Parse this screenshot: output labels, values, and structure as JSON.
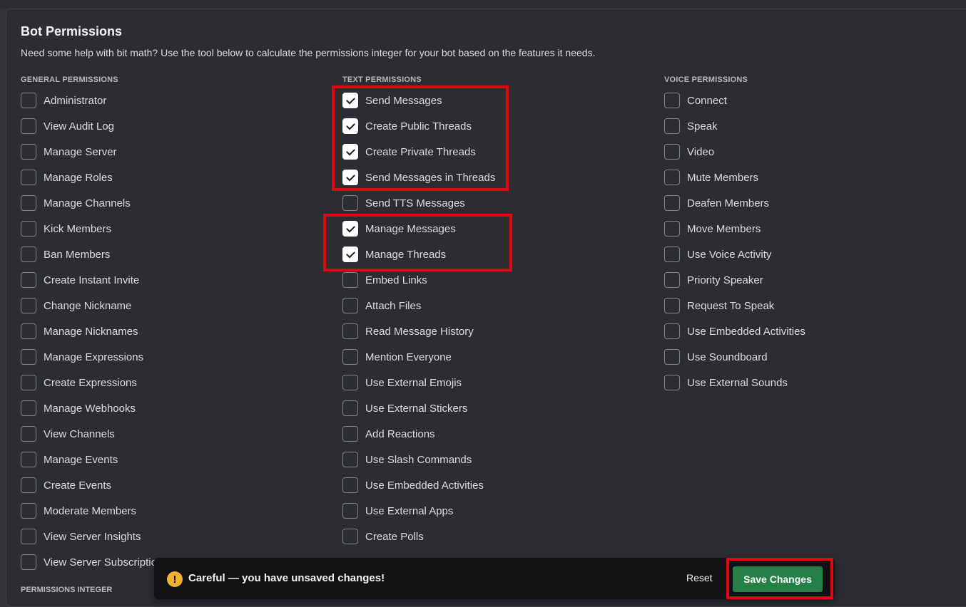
{
  "header": {
    "title": "Bot Permissions",
    "description": "Need some help with bit math? Use the tool below to calculate the permissions integer for your bot based on the features it needs."
  },
  "columns": [
    {
      "heading": "GENERAL PERMISSIONS",
      "items": [
        {
          "label": "Administrator",
          "checked": false
        },
        {
          "label": "View Audit Log",
          "checked": false
        },
        {
          "label": "Manage Server",
          "checked": false
        },
        {
          "label": "Manage Roles",
          "checked": false
        },
        {
          "label": "Manage Channels",
          "checked": false
        },
        {
          "label": "Kick Members",
          "checked": false
        },
        {
          "label": "Ban Members",
          "checked": false
        },
        {
          "label": "Create Instant Invite",
          "checked": false
        },
        {
          "label": "Change Nickname",
          "checked": false
        },
        {
          "label": "Manage Nicknames",
          "checked": false
        },
        {
          "label": "Manage Expressions",
          "checked": false
        },
        {
          "label": "Create Expressions",
          "checked": false
        },
        {
          "label": "Manage Webhooks",
          "checked": false
        },
        {
          "label": "View Channels",
          "checked": false
        },
        {
          "label": "Manage Events",
          "checked": false
        },
        {
          "label": "Create Events",
          "checked": false
        },
        {
          "label": "Moderate Members",
          "checked": false
        },
        {
          "label": "View Server Insights",
          "checked": false
        },
        {
          "label": "View Server Subscriptio",
          "checked": false
        }
      ]
    },
    {
      "heading": "TEXT PERMISSIONS",
      "items": [
        {
          "label": "Send Messages",
          "checked": true
        },
        {
          "label": "Create Public Threads",
          "checked": true
        },
        {
          "label": "Create Private Threads",
          "checked": true
        },
        {
          "label": "Send Messages in Threads",
          "checked": true
        },
        {
          "label": "Send TTS Messages",
          "checked": false
        },
        {
          "label": "Manage Messages",
          "checked": true
        },
        {
          "label": "Manage Threads",
          "checked": true
        },
        {
          "label": "Embed Links",
          "checked": false
        },
        {
          "label": "Attach Files",
          "checked": false
        },
        {
          "label": "Read Message History",
          "checked": false
        },
        {
          "label": "Mention Everyone",
          "checked": false
        },
        {
          "label": "Use External Emojis",
          "checked": false
        },
        {
          "label": "Use External Stickers",
          "checked": false
        },
        {
          "label": "Add Reactions",
          "checked": false
        },
        {
          "label": "Use Slash Commands",
          "checked": false
        },
        {
          "label": "Use Embedded Activities",
          "checked": false
        },
        {
          "label": "Use External Apps",
          "checked": false
        },
        {
          "label": "Create Polls",
          "checked": false
        }
      ]
    },
    {
      "heading": "VOICE PERMISSIONS",
      "items": [
        {
          "label": "Connect",
          "checked": false
        },
        {
          "label": "Speak",
          "checked": false
        },
        {
          "label": "Video",
          "checked": false
        },
        {
          "label": "Mute Members",
          "checked": false
        },
        {
          "label": "Deafen Members",
          "checked": false
        },
        {
          "label": "Move Members",
          "checked": false
        },
        {
          "label": "Use Voice Activity",
          "checked": false
        },
        {
          "label": "Priority Speaker",
          "checked": false
        },
        {
          "label": "Request To Speak",
          "checked": false
        },
        {
          "label": "Use Embedded Activities",
          "checked": false
        },
        {
          "label": "Use Soundboard",
          "checked": false
        },
        {
          "label": "Use External Sounds",
          "checked": false
        }
      ]
    }
  ],
  "permissions_integer": {
    "heading": "PERMISSIONS INTEGER"
  },
  "unsaved_notice": {
    "icon": "warning-icon",
    "icon_glyph": "!",
    "message": "Careful — you have unsaved changes!",
    "reset_label": "Reset",
    "save_label": "Save Changes"
  },
  "colors": {
    "background": "#2b2d31",
    "save_button": "#248046",
    "highlight_border": "#e30613",
    "warning": "#f0b232"
  }
}
